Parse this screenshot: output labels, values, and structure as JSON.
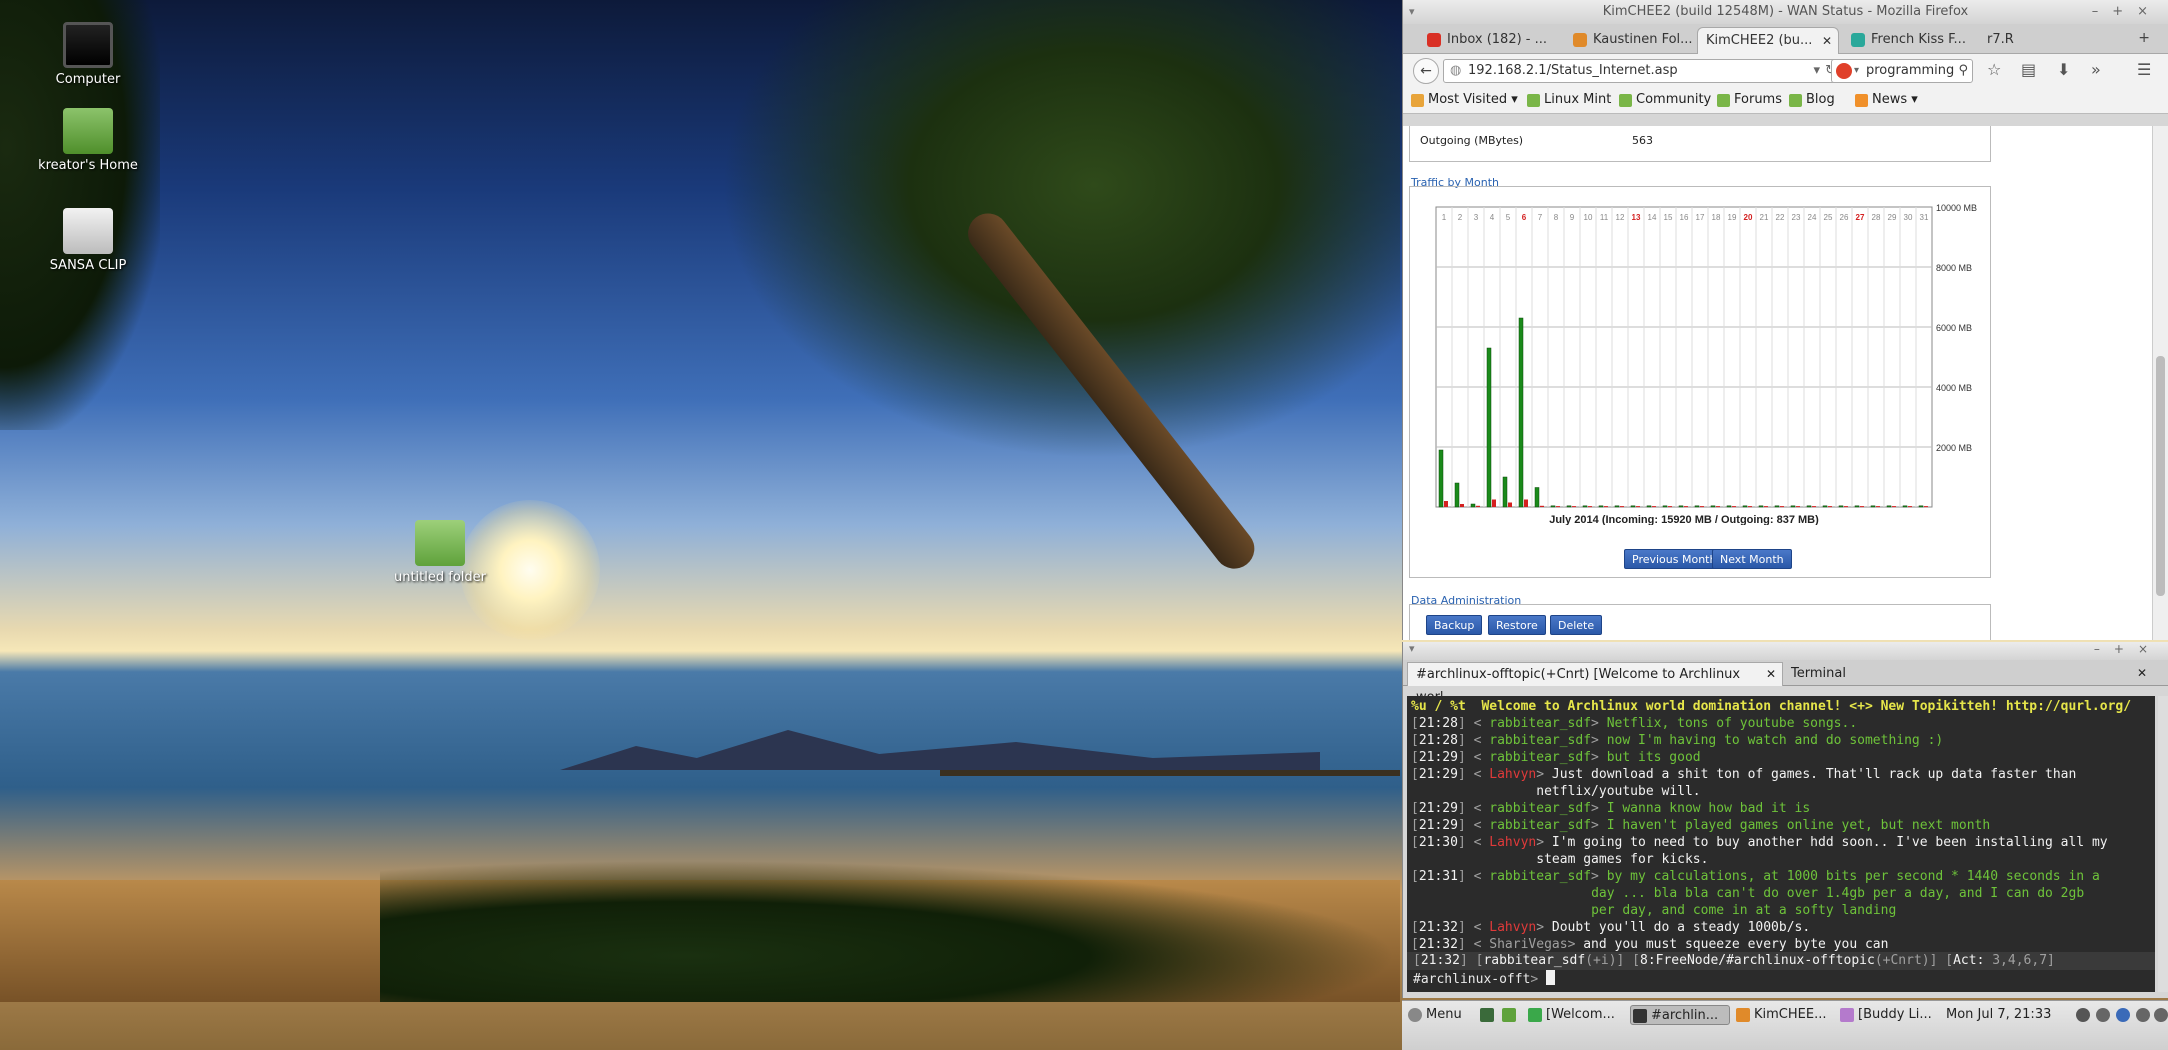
{
  "desktop": {
    "icons": [
      {
        "label": "Computer",
        "icon": "monitor-icon"
      },
      {
        "label": "kreator's Home",
        "icon": "home-folder-icon"
      },
      {
        "label": "SANSA CLIP",
        "icon": "usb-drive-icon"
      },
      {
        "label": "untitled folder",
        "icon": "folder-icon"
      }
    ]
  },
  "firefox": {
    "window_title": "KimCHEE2 (build 12548M) - WAN Status - Mozilla Firefox",
    "tabs": [
      {
        "label": "Inbox (182) - ...",
        "icon_color": "#d93025"
      },
      {
        "label": "Kaustinen Fol...",
        "icon_color": "#e08a2a"
      },
      {
        "label": "KimCHEE2 (bu...",
        "icon_color": "#888888",
        "active": true
      },
      {
        "label": "French Kiss F...",
        "icon_color": "#2aa89a"
      },
      {
        "label": "r7.R",
        "icon_color": "#cccccc"
      }
    ],
    "url": "192.168.2.1/Status_Internet.asp",
    "search_value": "programming",
    "bookmarks": [
      "Most Visited",
      "Linux Mint",
      "Community",
      "Forums",
      "Blog",
      "News"
    ]
  },
  "page": {
    "outgoing_label": "Outgoing (MBytes)",
    "outgoing_value": "563",
    "traffic_title": "Traffic by Month",
    "prev_button": "Previous Month",
    "next_button": "Next Month",
    "admin_title": "Data Administration",
    "admin_buttons": {
      "backup": "Backup",
      "restore": "Restore",
      "delete": "Delete"
    }
  },
  "chart_data": {
    "type": "bar",
    "title": "July 2014 (Incoming: 15920 MB / Outgoing: 837 MB)",
    "days": [
      "1",
      "2",
      "3",
      "4",
      "5",
      "6",
      "7",
      "8",
      "9",
      "10",
      "11",
      "12",
      "13",
      "14",
      "15",
      "16",
      "17",
      "18",
      "19",
      "20",
      "21",
      "22",
      "23",
      "24",
      "25",
      "26",
      "27",
      "28",
      "29",
      "30",
      "31"
    ],
    "red_days": [
      "6",
      "13",
      "20",
      "27"
    ],
    "ylim": [
      0,
      10000
    ],
    "y_ticks": [
      "10000 MB",
      "8000 MB",
      "6000 MB",
      "4000 MB",
      "2000 MB"
    ],
    "series": [
      {
        "color": "#1a8a1a",
        "values": [
          1900,
          800,
          100,
          5300,
          1000,
          6300,
          650,
          40,
          40,
          40,
          40,
          40,
          40,
          40,
          40,
          40,
          40,
          40,
          40,
          40,
          40,
          40,
          40,
          40,
          40,
          40,
          40,
          40,
          40,
          40,
          40
        ]
      },
      {
        "color": "#d42020",
        "values": [
          200,
          100,
          40,
          250,
          150,
          250,
          40,
          30,
          30,
          30,
          30,
          30,
          30,
          30,
          30,
          30,
          30,
          30,
          30,
          30,
          30,
          30,
          30,
          30,
          30,
          30,
          30,
          30,
          30,
          30,
          30
        ]
      }
    ]
  },
  "terminal": {
    "tab_irc": "#archlinux-offtopic(+Cnrt) [Welcome to Archlinux worl...",
    "tab_terminal": "Terminal",
    "topic": "%u / %t  Welcome to Archlinux world domination channel! <+> New Topikitteh! http://qurl.org/",
    "lines": [
      {
        "time": "21:28",
        "nick": "rabbitear_sdf",
        "nick_color": "green",
        "msg": "Netflix, tons of youtube songs..",
        "msg_color": "green"
      },
      {
        "time": "21:28",
        "nick": "rabbitear_sdf",
        "nick_color": "green",
        "msg": "now I'm having to watch and do something :)",
        "msg_color": "green"
      },
      {
        "time": "21:29",
        "nick": "rabbitear_sdf",
        "nick_color": "green",
        "msg": "but its good",
        "msg_color": "green"
      },
      {
        "time": "21:29",
        "nick": "Lahvyn",
        "nick_color": "red",
        "msg": "Just download a shit ton of games. That'll rack up data faster than",
        "msg_color": "white",
        "cont": [
          "netflix/youtube will."
        ]
      },
      {
        "time": "21:29",
        "nick": "rabbitear_sdf",
        "nick_color": "green",
        "msg": "I wanna know how bad it is",
        "msg_color": "green"
      },
      {
        "time": "21:29",
        "nick": "rabbitear_sdf",
        "nick_color": "green",
        "msg": "I haven't played games online yet, but next month",
        "msg_color": "green"
      },
      {
        "time": "21:30",
        "nick": "Lahvyn",
        "nick_color": "red",
        "msg": "I'm going to need to buy another hdd soon.. I've been installing all my",
        "msg_color": "white",
        "cont": [
          "steam games for kicks."
        ]
      },
      {
        "time": "21:31",
        "nick": "rabbitear_sdf",
        "nick_color": "green",
        "msg": "by my calculations, at 1000 bits per second * 1440 seconds in a",
        "msg_color": "green",
        "cont": [
          "day ... bla bla can't do over 1.4gb per a day, and I can do 2gb",
          "per day, and come in at a softy landing"
        ]
      },
      {
        "time": "21:32",
        "nick": "Lahvyn",
        "nick_color": "red",
        "msg": "Doubt you'll do a steady 1000b/s.",
        "msg_color": "white"
      },
      {
        "time": "21:32",
        "nick": "ShariVegas",
        "nick_color": "gray",
        "msg": "and you must squeeze every byte you can",
        "msg_color": "white"
      }
    ],
    "status": {
      "time": "21:32",
      "user": "rabbitear_sdf",
      "mode": "+i",
      "channel": "8:FreeNode/#archlinux-offtopic",
      "chanmode": "+Cnrt",
      "act_label": "Act:",
      "act": "3,4,6,7"
    },
    "prompt": "#archlinux-offt"
  },
  "panel": {
    "menu": "Menu",
    "tasks": [
      {
        "label": "[Welcom...",
        "icon_color": "#3aa84a"
      },
      {
        "label": "#archlin...",
        "icon_color": "#333333",
        "active": true
      },
      {
        "label": "KimCHEE...",
        "icon_color": "#e08a2a"
      },
      {
        "label": "[Buddy Li...",
        "icon_color": "#b47acc"
      }
    ],
    "clock": "Mon Jul  7, 21:33"
  }
}
